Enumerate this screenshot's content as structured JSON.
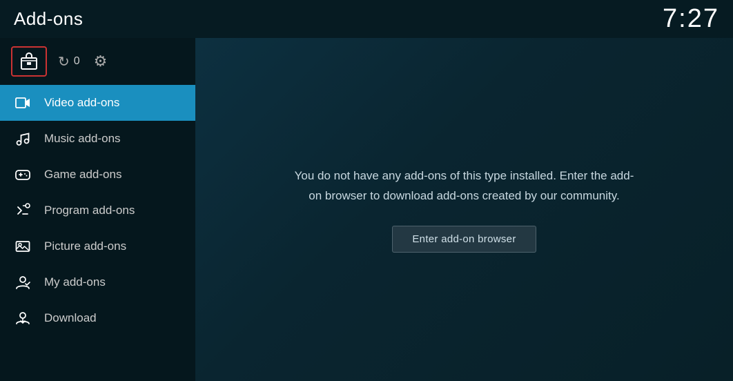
{
  "header": {
    "title": "Add-ons",
    "clock": "7:27"
  },
  "toolbar": {
    "update_count": "0"
  },
  "sidebar": {
    "items": [
      {
        "id": "video-addons",
        "label": "Video add-ons",
        "icon": "video-icon",
        "active": true
      },
      {
        "id": "music-addons",
        "label": "Music add-ons",
        "icon": "music-icon",
        "active": false
      },
      {
        "id": "game-addons",
        "label": "Game add-ons",
        "icon": "game-icon",
        "active": false
      },
      {
        "id": "program-addons",
        "label": "Program add-ons",
        "icon": "program-icon",
        "active": false
      },
      {
        "id": "picture-addons",
        "label": "Picture add-ons",
        "icon": "picture-icon",
        "active": false
      },
      {
        "id": "my-addons",
        "label": "My add-ons",
        "icon": "myaddon-icon",
        "active": false
      },
      {
        "id": "download",
        "label": "Download",
        "icon": "download-icon",
        "active": false
      }
    ]
  },
  "content": {
    "message": "You do not have any add-ons of this type installed. Enter the add-on browser to download add-ons created by our community.",
    "button_label": "Enter add-on browser"
  }
}
